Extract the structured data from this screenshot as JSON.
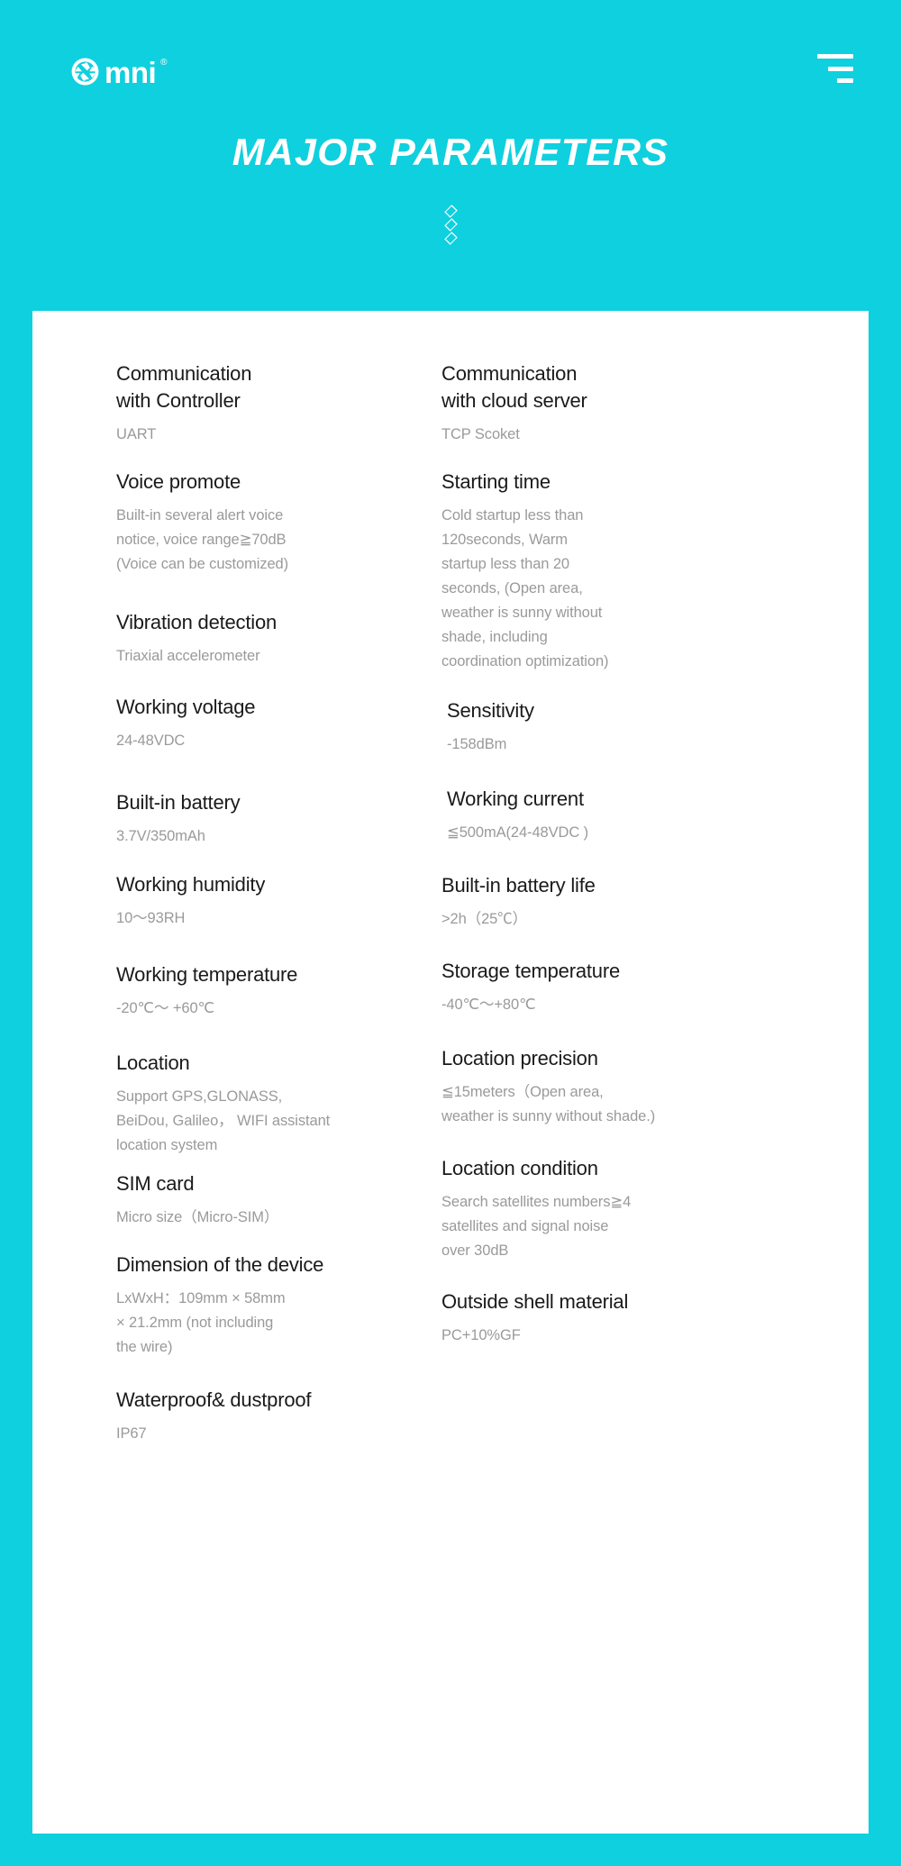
{
  "header": {
    "brand_name": "mni",
    "brand_mark_icon": "aperture-icon",
    "registered_mark": "®",
    "menu_icon": "hamburger-menu-icon",
    "title": "MAJOR PARAMETERS",
    "ornament_icon": "diamond-divider-icon",
    "background_color": "#0fd0de"
  },
  "specs": {
    "left": [
      {
        "label": "Communication\nwith Controller",
        "value": "UART",
        "gap_before": 0
      },
      {
        "label": "Voice promote",
        "value": "Built-in several alert voice\nnotice, voice range≧70dB\n(Voice can be customized)",
        "gap_before": 24
      },
      {
        "label": "Vibration detection",
        "value": "Triaxial accelerometer",
        "gap_before": 36
      },
      {
        "label": "Working voltage",
        "value": "24-48VDC",
        "gap_before": 28
      },
      {
        "label": "Built-in battery",
        "value": "3.7V/350mAh",
        "gap_before": 40
      },
      {
        "label": "Working humidity",
        "value": "10〜93RH",
        "gap_before": 25
      },
      {
        "label": "Working temperature",
        "value": "-20℃〜 +60℃",
        "gap_before": 34
      },
      {
        "label": "Location",
        "value": "Support  GPS,GLONASS,\nBeiDou, Galileo，  WIFI assistant\nlocation system",
        "gap_before": 32
      },
      {
        "label": "SIM card",
        "value": "Micro size（Micro-SIM）",
        "gap_before": 14
      },
      {
        "label": "Dimension of the device",
        "value": " LxWxH：109mm × 58mm\n× 21.2mm (not including\nthe wire)",
        "gap_before": 24
      },
      {
        "label": "Waterproof& dustproof",
        "value": "IP67",
        "gap_before": 30
      }
    ],
    "right": [
      {
        "label": "Communication\nwith cloud server",
        "value": "TCP Scoket",
        "gap_before": 0,
        "indent": false
      },
      {
        "label": "Starting time",
        "value": "Cold startup less than\n120seconds, Warm\nstartup less than 20\nseconds, (Open area,\nweather is sunny without\nshade, including\ncoordination optimization)",
        "gap_before": 24,
        "indent": false
      },
      {
        "label": " Sensitivity",
        "value": "-158dBm",
        "gap_before": 26,
        "indent": true
      },
      {
        "label": " Working current",
        "value": "≦500mA(24-48VDC )",
        "gap_before": 32,
        "indent": true
      },
      {
        "label": "Built-in battery life",
        "value": ">2h（25℃）",
        "gap_before": 30,
        "indent": false
      },
      {
        "label": "Storage temperature",
        "value": " -40℃〜+80℃",
        "gap_before": 29,
        "indent": false
      },
      {
        "label": "Location precision",
        "value": "≦15meters（Open area,\nweather is sunny without shade.)",
        "gap_before": 31,
        "indent": false
      },
      {
        "label": "Location condition",
        "value": "Search satellites numbers≧4\nsatellites and signal noise\nover 30dB",
        "gap_before": 29,
        "indent": false
      },
      {
        "label": "Outside shell material",
        "value": "PC+10%GF",
        "gap_before": 28,
        "indent": false
      }
    ]
  }
}
